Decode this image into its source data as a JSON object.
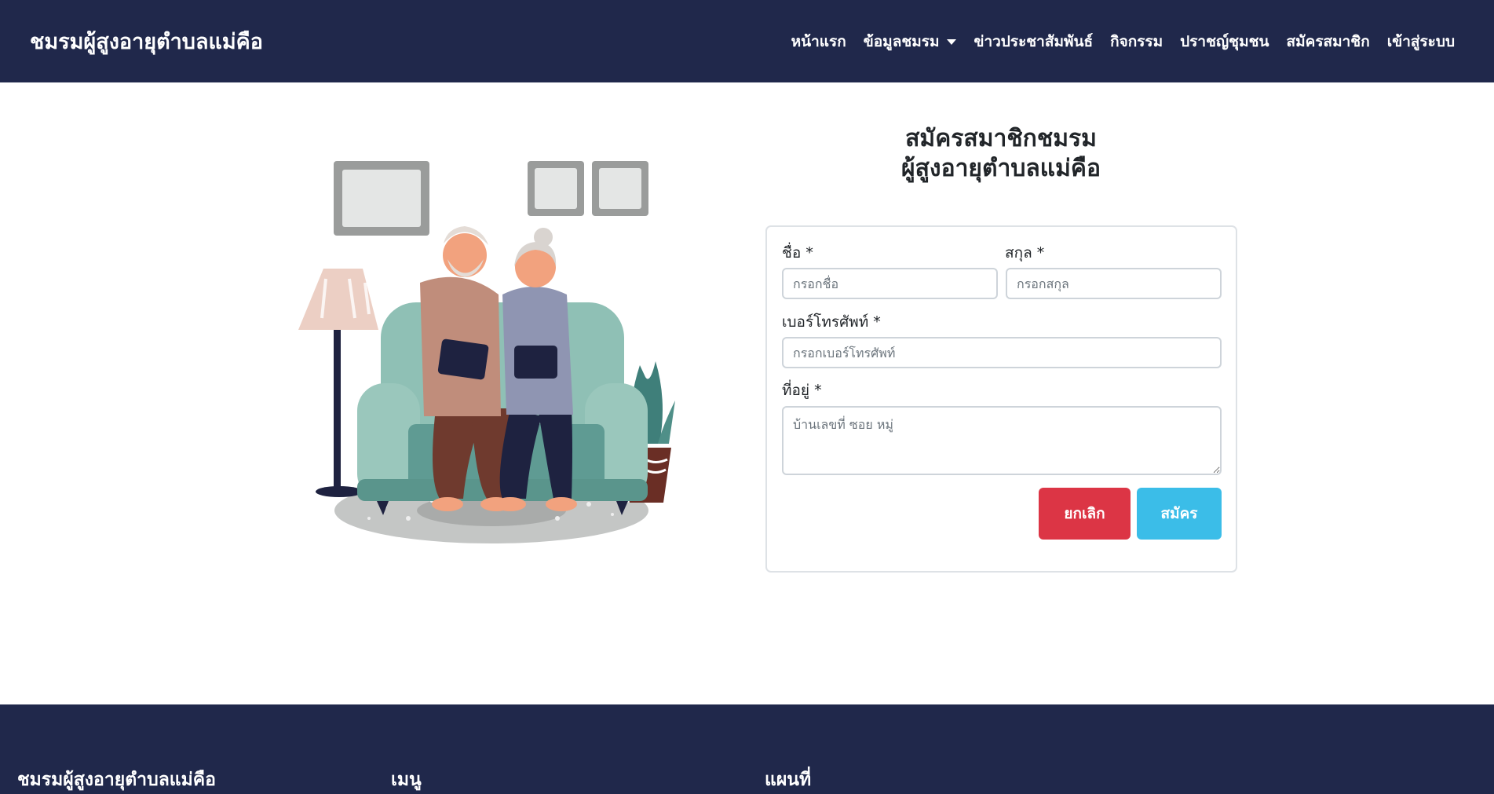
{
  "navbar": {
    "brand": "ชมรมผู้สูงอายุตำบลแม่คือ",
    "links": [
      {
        "label": "หน้าแรก"
      },
      {
        "label": "ข้อมูลชมรม",
        "dropdown": true
      },
      {
        "label": "ข่าวประชาสัมพันธ์"
      },
      {
        "label": "กิจกรรม"
      },
      {
        "label": "ปราชญ์ชุมชน"
      },
      {
        "label": "สมัครสมาชิก"
      },
      {
        "label": "เข้าสู่ระบบ"
      }
    ]
  },
  "illustration": {
    "icon": "elderly-couple-on-sofa-illustration",
    "colors": {
      "sofa": "#7fb3a8",
      "frame": "#9a9c9b",
      "lamp": "#eccfc4",
      "pot": "#6a2e25"
    }
  },
  "register": {
    "title_line1": "สมัครสมาชิกชมรม",
    "title_line2": "ผู้สูงอายุตำบลแม่คือ",
    "first_name": {
      "label": "ชื่อ *",
      "placeholder": "กรอกชื่อ",
      "value": ""
    },
    "last_name": {
      "label": "สกุล *",
      "placeholder": "กรอกสกุล",
      "value": ""
    },
    "phone": {
      "label": "เบอร์โทรศัพท์ *",
      "placeholder": "กรอกเบอร์โทรศัพท์",
      "value": ""
    },
    "address": {
      "label": "ที่อยู่ *",
      "placeholder": "บ้านเลขที่ ซอย หมู่",
      "value": ""
    },
    "cancel_label": "ยกเลิก",
    "submit_label": "สมัคร"
  },
  "footer": {
    "col1_title": "ชมรมผู้สูงอายุตำบลแม่คือ",
    "col2_title": "เมนู",
    "col3_title": "แผนที่"
  },
  "colors": {
    "navbar_bg": "#20284b",
    "cancel_button": "#dc3545",
    "submit_button": "#3bbde8"
  }
}
